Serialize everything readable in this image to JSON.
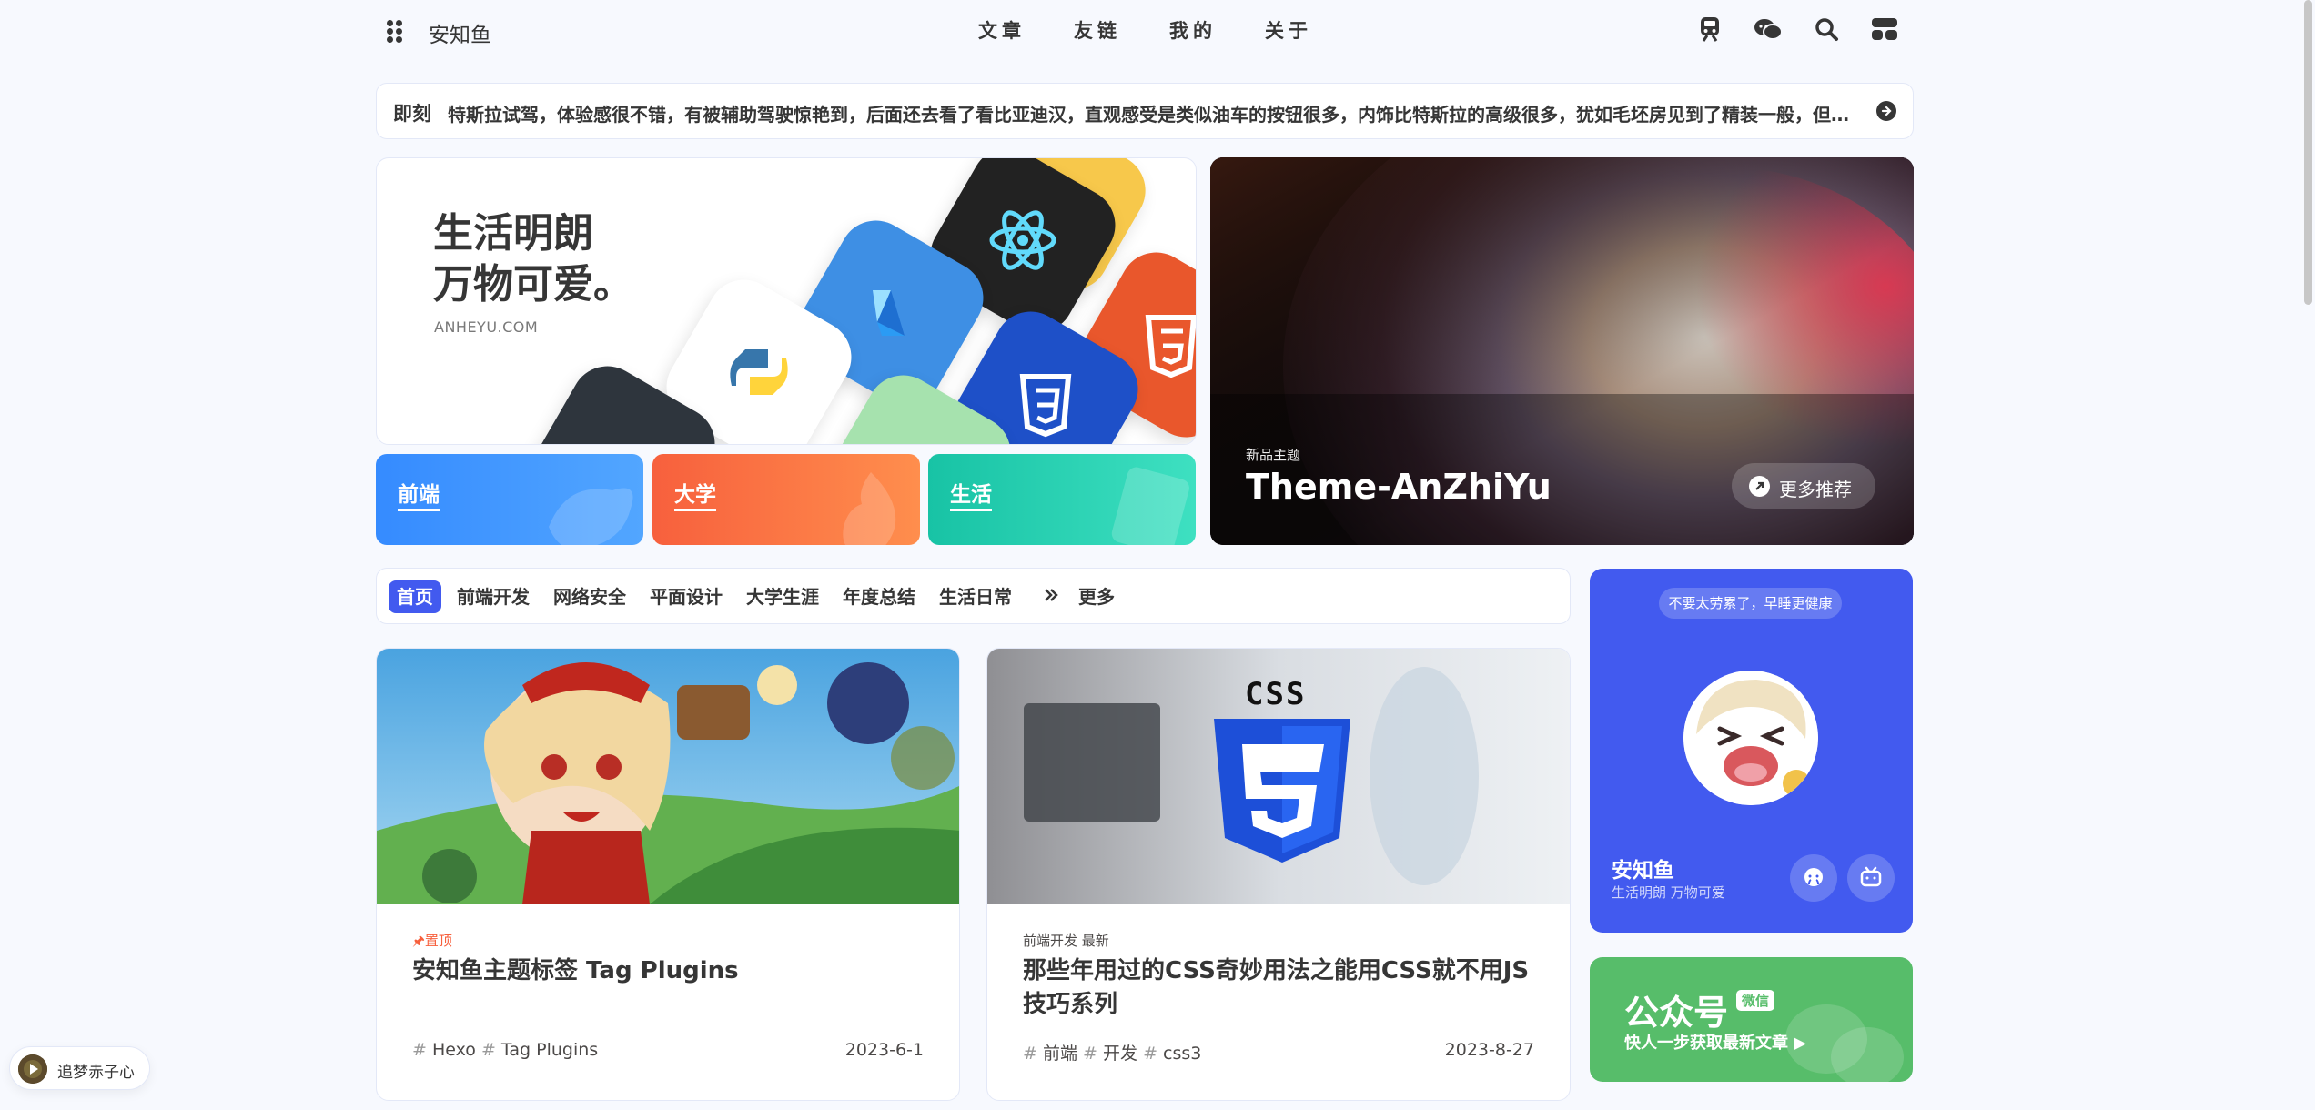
{
  "nav": {
    "site_name": "安知鱼",
    "menu": [
      "文章",
      "友链",
      "我的",
      "关于"
    ],
    "icons": [
      "train-icon",
      "chat-icon",
      "search-icon",
      "console-icon"
    ]
  },
  "announcement": {
    "tag": "即刻",
    "text": "特斯拉试驾，体验感很不错，有被辅助驾驶惊艳到，后面还去看了看比亚迪汉，直观感受是类似油车的按钮很多，内饰比特斯拉的高级很多，犹如毛坯房见到了精装一般，但是..."
  },
  "hero": {
    "title_line1": "生活明朗",
    "title_line2": "万物可爱。",
    "subtitle": "ANHEYU.COM"
  },
  "categories": [
    {
      "label": "前端",
      "color": "#3e8ef7"
    },
    {
      "label": "大学",
      "color": "#f76e3f"
    },
    {
      "label": "生活",
      "color": "#1ecaa8"
    }
  ],
  "featured": {
    "small": "新品主题",
    "title": "Theme-AnZhiYu",
    "button": "更多推荐"
  },
  "tabs": {
    "items": [
      "首页",
      "前端开发",
      "网络安全",
      "平面设计",
      "大学生涯",
      "年度总结",
      "生活日常"
    ],
    "more": "更多"
  },
  "posts": [
    {
      "meta": "置顶",
      "title": "安知鱼主题标签 Tag Plugins",
      "tags": [
        "Hexo",
        "Tag Plugins"
      ],
      "date": "2023-6-1"
    },
    {
      "meta": "前端开发   最新",
      "title": "那些年用过的CSS奇妙用法之能用CSS就不用JS技巧系列",
      "tags": [
        "前端",
        "开发",
        "css3"
      ],
      "date": "2023-8-27",
      "image_text": "CSS"
    }
  ],
  "author": {
    "pill": "不要太劳累了，早睡更健康",
    "name": "安知鱼",
    "desc": "生活明朗 万物可爱"
  },
  "wechat": {
    "title": "公众号",
    "badge": "微信",
    "sub": "快人一步获取最新文章 ▶"
  },
  "music": {
    "label": "追梦赤子心"
  }
}
